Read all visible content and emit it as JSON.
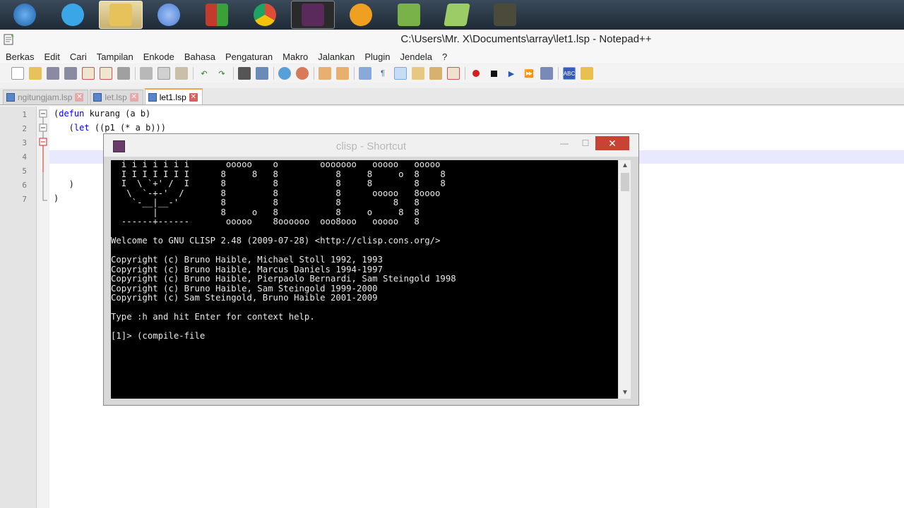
{
  "taskbar": {
    "buttons": [
      {
        "name": "start-button",
        "icon": "windows-orb-icon",
        "color": "#2f7fd0"
      },
      {
        "name": "internet-explorer",
        "icon": "internet-explorer-icon",
        "color": "#3aa6e8"
      },
      {
        "name": "file-explorer",
        "icon": "folder-icon",
        "color": "#e7c15a"
      },
      {
        "name": "firefox-like",
        "icon": "swirl-icon",
        "color": "#4d7dd8"
      },
      {
        "name": "office-like",
        "icon": "office-icon",
        "color": "#c33b2c"
      },
      {
        "name": "chrome",
        "icon": "chrome-icon",
        "color": "#dd4b39"
      },
      {
        "name": "clisp",
        "icon": "menorah-icon",
        "color": "#5a2b5a"
      },
      {
        "name": "tool-app",
        "icon": "key-icon",
        "color": "#f0a020"
      },
      {
        "name": "notepadpp",
        "icon": "notepad-icon",
        "color": "#7ab24a"
      },
      {
        "name": "notes",
        "icon": "paper-icon",
        "color": "#9ccc65"
      },
      {
        "name": "camera",
        "icon": "camcorder-icon",
        "color": "#4b4b3b"
      }
    ]
  },
  "window": {
    "title": "C:\\Users\\Mr. X\\Documents\\array\\let1.lsp - Notepad++"
  },
  "menu": [
    "Berkas",
    "Edit",
    "Cari",
    "Tampilan",
    "Enkode",
    "Bahasa",
    "Pengaturan",
    "Makro",
    "Jalankan",
    "Plugin",
    "Jendela",
    "?"
  ],
  "tabs": [
    {
      "label": "ngitungjam.lsp",
      "active": false
    },
    {
      "label": "let.lsp",
      "active": false
    },
    {
      "label": "let1.lsp",
      "active": true
    }
  ],
  "editor": {
    "line_numbers": [
      "1",
      "2",
      "3",
      "4",
      "5",
      "6",
      "7"
    ],
    "lines": {
      "l1_open": "(",
      "l1_kw": "defun",
      "l1_rest": " kurang (a b)",
      "l2_open": "   (",
      "l2_kw": "let",
      "l2_rest": " ((p1 (* a b)))",
      "l6": "   )",
      "l7": ")"
    }
  },
  "console": {
    "title": "clisp - Shortcut",
    "close_label": "✕",
    "minimize_label": "—",
    "maximize_label": "☐",
    "text": "  i i i i i i i       ooooo    o        ooooooo   ooooo   ooooo\n  I I I I I I I      8     8   8           8     8     o  8    8\n  I  \\ `+' /  I      8         8           8     8        8    8\n   \\  `-+-'  /       8         8           8      ooooo   8oooo\n    `-__|__-'        8         8           8          8   8\n        |            8     o   8           8     o     8  8\n  ------+------       ooooo    8oooooo  ooo8ooo   ooooo   8\n\nWelcome to GNU CLISP 2.48 (2009-07-28) <http://clisp.cons.org/>\n\nCopyright (c) Bruno Haible, Michael Stoll 1992, 1993\nCopyright (c) Bruno Haible, Marcus Daniels 1994-1997\nCopyright (c) Bruno Haible, Pierpaolo Bernardi, Sam Steingold 1998\nCopyright (c) Bruno Haible, Sam Steingold 1999-2000\nCopyright (c) Sam Steingold, Bruno Haible 2001-2009\n\nType :h and hit Enter for context help.\n\n[1]> (compile-file"
  }
}
